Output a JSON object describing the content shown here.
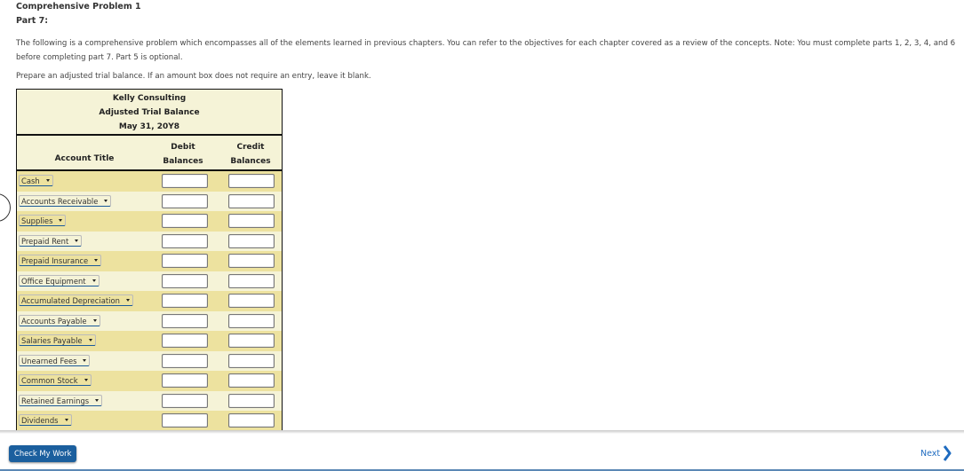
{
  "header": {
    "title": "Comprehensive Problem 1",
    "part": "Part 7:"
  },
  "intro": "The following is a comprehensive problem which encompasses all of the elements learned in previous chapters. You can refer to the objectives for each chapter covered as a review of the concepts. Note: You must complete parts 1, 2, 3, 4, and 6 before completing part 7. Part 5 is optional.",
  "instructions": "Prepare an adjusted trial balance. If an amount box does not require an entry, leave it blank.",
  "table": {
    "company": "Kelly Consulting",
    "statement": "Adjusted Trial Balance",
    "date": "May 31, 20Y8",
    "columns": {
      "account": "Account Title",
      "debit_1": "Debit",
      "debit_2": "Balances",
      "credit_1": "Credit",
      "credit_2": "Balances"
    },
    "rows": [
      {
        "account": "Cash",
        "debit": "",
        "credit": ""
      },
      {
        "account": "Accounts Receivable",
        "debit": "",
        "credit": ""
      },
      {
        "account": "Supplies",
        "debit": "",
        "credit": ""
      },
      {
        "account": "Prepaid Rent",
        "debit": "",
        "credit": ""
      },
      {
        "account": "Prepaid Insurance",
        "debit": "",
        "credit": ""
      },
      {
        "account": "Office Equipment",
        "debit": "",
        "credit": ""
      },
      {
        "account": "Accumulated Depreciation",
        "debit": "",
        "credit": ""
      },
      {
        "account": "Accounts Payable",
        "debit": "",
        "credit": ""
      },
      {
        "account": "Salaries Payable",
        "debit": "",
        "credit": ""
      },
      {
        "account": "Unearned Fees",
        "debit": "",
        "credit": ""
      },
      {
        "account": "Common Stock",
        "debit": "",
        "credit": ""
      },
      {
        "account": "Retained Earnings",
        "debit": "",
        "credit": ""
      },
      {
        "account": "Dividends",
        "debit": "",
        "credit": ""
      }
    ]
  },
  "footer": {
    "check_label": "Check My Work",
    "next_label": "Next"
  },
  "colors": {
    "row_dark": "#ede29f",
    "row_light": "#f5f3d7",
    "button": "#1b5f9e",
    "link": "#1e6bc0"
  }
}
